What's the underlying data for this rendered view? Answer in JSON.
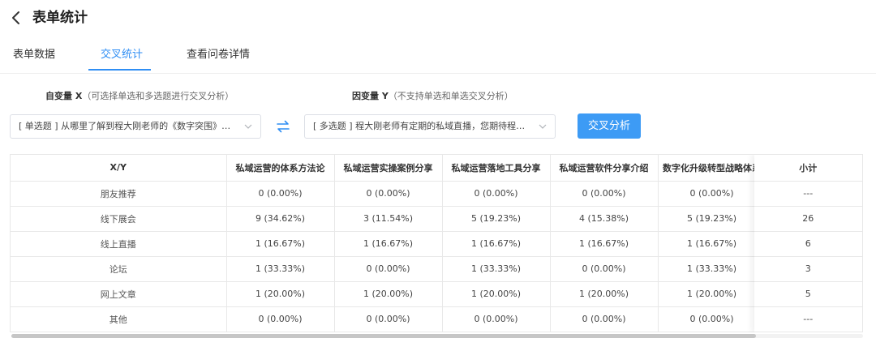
{
  "header": {
    "title": "表单统计",
    "back_icon": "chevron-left-icon"
  },
  "tabs": [
    {
      "label": "表单数据",
      "active": false
    },
    {
      "label": "交叉统计",
      "active": true
    },
    {
      "label": "查看问卷详情",
      "active": false
    }
  ],
  "controls": {
    "x_label_bold": "自变量 X",
    "x_label_hint": "（可选择单选和多选题进行交叉分析）",
    "y_label_bold": "因变量 Y",
    "y_label_hint": "（不支持单选和单选交叉分析）",
    "x_select_value": "[ 单选题 ] 从哪里了解到程大刚老师的《数字突围》和他...",
    "y_select_value": "[ 多选题 ] 程大刚老师有定期的私域直播，您期待程大刚...",
    "swap_icon": "swap-arrows-icon",
    "analyze_button": "交叉分析"
  },
  "colors": {
    "accent": "#2f8ef4",
    "button": "#3d9bf5"
  },
  "table": {
    "corner_header": "X/Y",
    "columns": [
      "私域运营的体系方法论",
      "私域运营实操案例分享",
      "私域运营落地工具分享",
      "私域运营软件分享介绍",
      "数字化升级转型战略体系"
    ],
    "subtotal_header": "小计",
    "rows": [
      {
        "label": "朋友推荐",
        "cells": [
          "0  (0.00%)",
          "0  (0.00%)",
          "0  (0.00%)",
          "0  (0.00%)",
          "0  (0.00%)"
        ],
        "subtotal": "---"
      },
      {
        "label": "线下展会",
        "cells": [
          "9  (34.62%)",
          "3  (11.54%)",
          "5  (19.23%)",
          "4  (15.38%)",
          "5  (19.23%)"
        ],
        "subtotal": "26"
      },
      {
        "label": "线上直播",
        "cells": [
          "1  (16.67%)",
          "1  (16.67%)",
          "1  (16.67%)",
          "1  (16.67%)",
          "1  (16.67%)"
        ],
        "subtotal": "6"
      },
      {
        "label": "论坛",
        "cells": [
          "1  (33.33%)",
          "0  (0.00%)",
          "1  (33.33%)",
          "0  (0.00%)",
          "1  (33.33%)"
        ],
        "subtotal": "3"
      },
      {
        "label": "网上文章",
        "cells": [
          "1  (20.00%)",
          "1  (20.00%)",
          "1  (20.00%)",
          "1  (20.00%)",
          "1  (20.00%)"
        ],
        "subtotal": "5"
      },
      {
        "label": "其他",
        "cells": [
          "0  (0.00%)",
          "0  (0.00%)",
          "0  (0.00%)",
          "0  (0.00%)",
          "0  (0.00%)"
        ],
        "subtotal": "---"
      }
    ]
  }
}
